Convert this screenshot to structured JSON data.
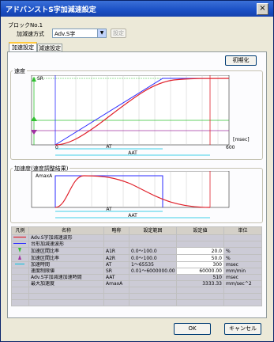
{
  "window": {
    "title": "アドバンストS字加減速設定",
    "close_icon": "×"
  },
  "block": {
    "label": "ブロックNo.1"
  },
  "accel_method": {
    "label": "加減速方式",
    "value": "Adv.S字",
    "settings_button": "設定"
  },
  "tabs": [
    {
      "label": "加速設定"
    },
    {
      "label": "減速設定"
    }
  ],
  "init_button": "初期化",
  "speed_chart": {
    "group_title": "速度",
    "sr_label": "SR",
    "unit_label": "[msec]",
    "x_start": "0",
    "x_end": "600",
    "at_label": "AT",
    "aat_label": "AAT"
  },
  "accel_chart": {
    "group_title": "加速度(速度調整結果)",
    "amax_label": "AmaxA",
    "at_label": "AT",
    "aat_label": "AAT"
  },
  "table": {
    "headers": [
      "凡例",
      "名称",
      "略称",
      "設定範囲",
      "設定値",
      "単位"
    ],
    "rows": [
      {
        "legend": "red-line",
        "name": "Adv.S字加減速波形",
        "abbr": "",
        "range": "",
        "value": "",
        "unit": ""
      },
      {
        "legend": "blue-line",
        "name": "台形加減速波形",
        "abbr": "",
        "range": "",
        "value": "",
        "unit": ""
      },
      {
        "legend": "green-marker",
        "name": "加速区間比率",
        "abbr": "A1R",
        "range": "0.0～100.0",
        "value": "20.0",
        "unit": "%"
      },
      {
        "legend": "purple-marker",
        "name": "加速区間比率",
        "abbr": "A2R",
        "range": "0.0～100.0",
        "value": "50.0",
        "unit": "%"
      },
      {
        "legend": "cyan-arrow",
        "name": "加速時間",
        "abbr": "AT",
        "range": "1～65535",
        "value": "300",
        "unit": "msec"
      },
      {
        "legend": "",
        "name": "速度制限値",
        "abbr": "SR",
        "range": "0.01～6000000.00",
        "value": "60000.00",
        "unit": "mm/min"
      },
      {
        "legend": "",
        "name": "Adv.S字加減速加速時間",
        "abbr": "AAT",
        "range": "",
        "value": "510",
        "unit": "msec"
      },
      {
        "legend": "",
        "name": "最大加速度",
        "abbr": "AmaxA",
        "range": "",
        "value": "3333.33",
        "unit": "mm/sec^2"
      }
    ]
  },
  "buttons": {
    "ok": "OK",
    "cancel": "キャンセル"
  },
  "colors": {
    "titlebar": "#1a4fc4",
    "red_curve": "#e0202a",
    "blue_curve": "#2a2aff",
    "green": "#30c030",
    "purple": "#a030a0",
    "cyan": "#00c0e0"
  }
}
